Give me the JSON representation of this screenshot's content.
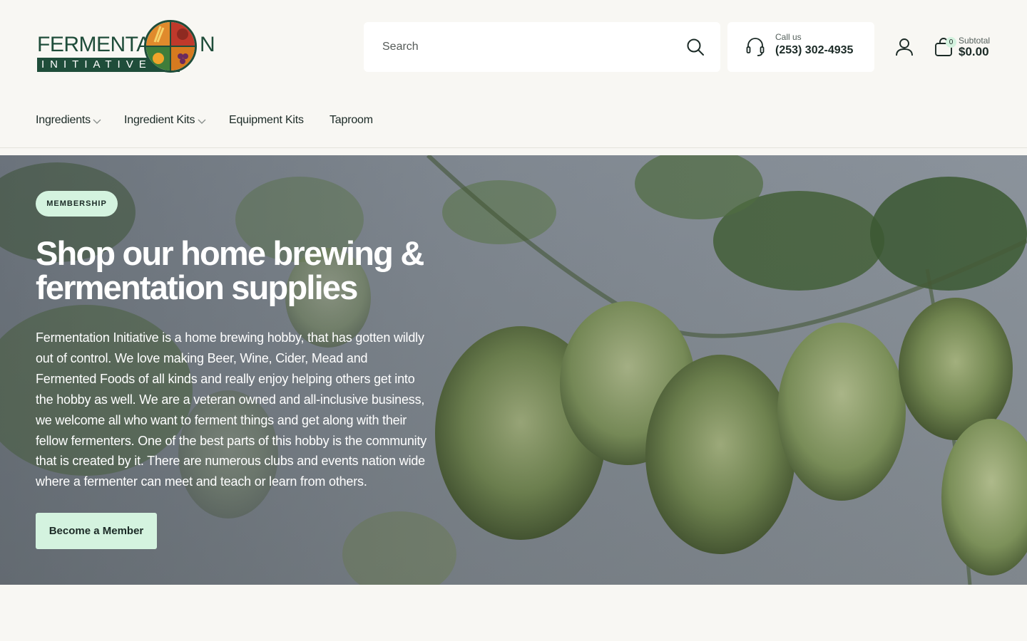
{
  "brand": {
    "logo_text_main": "FERMENTATION",
    "logo_text_sub": "INITIATIVE"
  },
  "search": {
    "placeholder": "Search"
  },
  "contact": {
    "label": "Call us",
    "phone": "(253) 302-4935"
  },
  "cart": {
    "count": "0",
    "subtotal_label": "Subtotal",
    "subtotal_value": "$0.00"
  },
  "nav": {
    "items": [
      {
        "label": "Ingredients",
        "has_dropdown": true
      },
      {
        "label": "Ingredient Kits",
        "has_dropdown": true
      },
      {
        "label": "Equipment Kits",
        "has_dropdown": false
      },
      {
        "label": "Taproom",
        "has_dropdown": false
      }
    ]
  },
  "hero": {
    "badge": "MEMBERSHIP",
    "title": "Shop our home brewing & fermentation supplies",
    "description": "Fermentation Initiative is a home brewing hobby, that has gotten wildly out of control. We love making Beer, Wine, Cider, Mead and Fermented Foods of all kinds and really enjoy helping others get into the hobby as well. We are a veteran owned and all-inclusive business, we welcome all who want to ferment things and get along with their fellow fermenters. One of the best parts of this hobby is the community that is created by it. There are numerous clubs and events nation wide where a fermenter can meet and teach or learn from others.",
    "cta": "Become a Member"
  },
  "colors": {
    "page_bg": "#f8f7f3",
    "accent_mint": "#d4f3df",
    "brand_green": "#1f4d3a",
    "text_dark": "#1b2a26"
  },
  "icons": [
    "search-icon",
    "headset-icon",
    "account-icon",
    "shopping-bag-icon",
    "chevron-down-icon"
  ]
}
